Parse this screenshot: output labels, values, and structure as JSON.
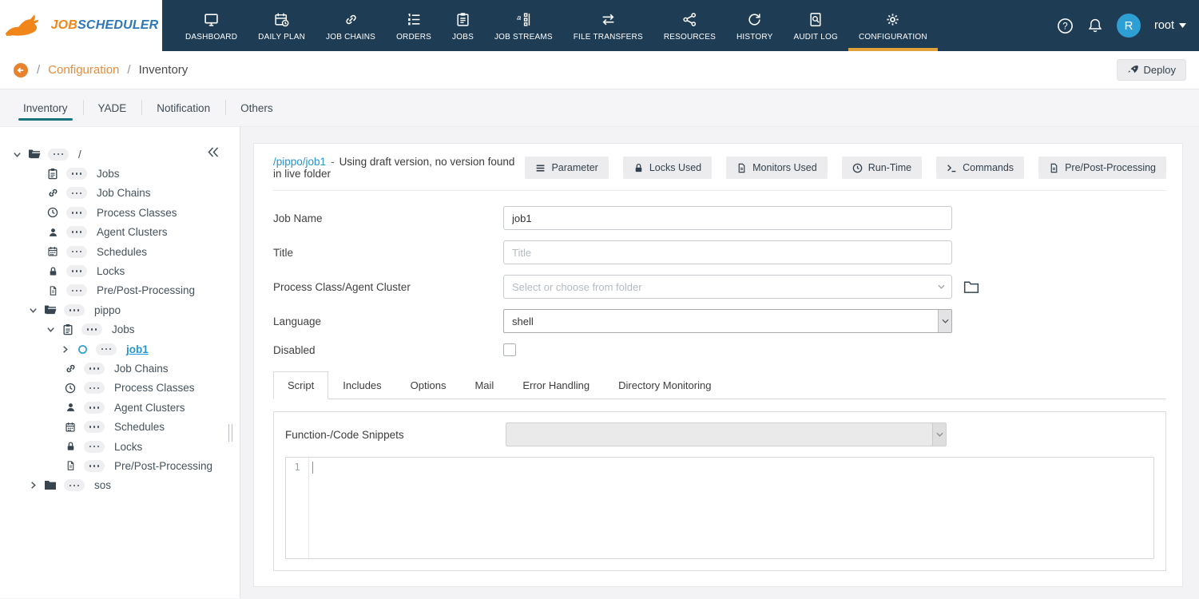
{
  "colors": {
    "navbar_bg": "#1e3c54",
    "brand_orange": "#f08519",
    "brand_blue": "#2e77b8",
    "nav_active_underline": "#e2a13b",
    "breadcrumb_link_orange": "#e78c3a",
    "tab_active_teal": "#17747c",
    "link_blue": "#2795d2",
    "avatar_blue": "#2e9fd4"
  },
  "navbar": {
    "brand": {
      "text_job": "JOB",
      "text_scheduler": "SCHEDULER",
      "logo_icon": "rabbit-logo-icon"
    },
    "items": [
      {
        "label": "DASHBOARD",
        "icon": "dashboard-icon",
        "active": false
      },
      {
        "label": "DAILY PLAN",
        "icon": "daily-plan-icon",
        "active": false
      },
      {
        "label": "JOB CHAINS",
        "icon": "job-chains-icon",
        "active": false
      },
      {
        "label": "ORDERS",
        "icon": "orders-icon",
        "active": false
      },
      {
        "label": "JOBS",
        "icon": "jobs-icon",
        "active": false
      },
      {
        "label": "JOB STREAMS",
        "icon": "job-streams-icon",
        "active": false
      },
      {
        "label": "FILE TRANSFERS",
        "icon": "file-transfers-icon",
        "active": false
      },
      {
        "label": "RESOURCES",
        "icon": "resources-icon",
        "active": false
      },
      {
        "label": "HISTORY",
        "icon": "history-icon",
        "active": false
      },
      {
        "label": "AUDIT LOG",
        "icon": "audit-log-icon",
        "active": false
      },
      {
        "label": "CONFIGURATION",
        "icon": "configuration-icon",
        "active": true
      }
    ],
    "right_icons": [
      "help-icon",
      "bell-icon"
    ],
    "user": {
      "initial": "R",
      "name": "root"
    }
  },
  "breadcrumb": {
    "back_icon": "back-circle-icon",
    "sep": "/",
    "section": "Configuration",
    "page": "Inventory",
    "deploy_label": "Deploy",
    "deploy_icon": "rocket-icon"
  },
  "page_tabs": [
    {
      "label": "Inventory",
      "active": true
    },
    {
      "label": "YADE",
      "active": false
    },
    {
      "label": "Notification",
      "active": false
    },
    {
      "label": "Others",
      "active": false
    }
  ],
  "tree": {
    "collapse_icon": "collapse-double-chevron-icon",
    "rows": [
      {
        "label": "/",
        "icon": "folder-open-icon",
        "chevron": "down",
        "level": 0
      },
      {
        "label": "Jobs",
        "icon": "clipboard-icon",
        "level": 1
      },
      {
        "label": "Job Chains",
        "icon": "chain-icon",
        "level": 1
      },
      {
        "label": "Process Classes",
        "icon": "clock-icon",
        "level": 1
      },
      {
        "label": "Agent Clusters",
        "icon": "user-icon",
        "level": 1
      },
      {
        "label": "Schedules",
        "icon": "calendar-icon",
        "level": 1
      },
      {
        "label": "Locks",
        "icon": "lock-icon",
        "level": 1
      },
      {
        "label": "Pre/Post-Processing",
        "icon": "document-icon",
        "level": 1
      },
      {
        "label": "pippo",
        "icon": "folder-open-icon",
        "chevron": "down",
        "level": 1
      },
      {
        "label": "Jobs",
        "icon": "clipboard-icon",
        "chevron": "down",
        "level": 2
      },
      {
        "label": "job1",
        "icon": "circle-icon",
        "chevron": "right",
        "level": 3,
        "selected": true
      },
      {
        "label": "Job Chains",
        "icon": "chain-icon",
        "level": 3
      },
      {
        "label": "Process Classes",
        "icon": "clock-icon",
        "level": 3
      },
      {
        "label": "Agent Clusters",
        "icon": "user-icon",
        "level": 3
      },
      {
        "label": "Schedules",
        "icon": "calendar-icon",
        "level": 3
      },
      {
        "label": "Locks",
        "icon": "lock-icon",
        "level": 3
      },
      {
        "label": "Pre/Post-Processing",
        "icon": "document-icon",
        "level": 3
      },
      {
        "label": "sos",
        "icon": "folder-closed-icon",
        "chevron": "right",
        "level": 1
      }
    ]
  },
  "main": {
    "title_path": "/pippo/job1",
    "title_sep": "-",
    "title_note": "Using draft version, no version found in live folder",
    "header_buttons": [
      {
        "label": "Parameter",
        "icon": "parameter-icon"
      },
      {
        "label": "Locks Used",
        "icon": "lock-icon"
      },
      {
        "label": "Monitors Used",
        "icon": "document-icon"
      },
      {
        "label": "Run-Time",
        "icon": "runtime-clock-icon"
      },
      {
        "label": "Commands",
        "icon": "terminal-icon"
      },
      {
        "label": "Pre/Post-Processing",
        "icon": "document-icon"
      }
    ],
    "form": {
      "job_name": {
        "label": "Job Name",
        "value": "job1"
      },
      "title": {
        "label": "Title",
        "placeholder": "Title"
      },
      "process_class": {
        "label": "Process Class/Agent Cluster",
        "placeholder": "Select or choose from folder",
        "folder_icon": "folder-outline-icon"
      },
      "language": {
        "label": "Language",
        "value": "shell"
      },
      "disabled": {
        "label": "Disabled",
        "checked": false
      }
    },
    "script_tabs": [
      {
        "label": "Script",
        "active": true
      },
      {
        "label": "Includes",
        "active": false
      },
      {
        "label": "Options",
        "active": false
      },
      {
        "label": "Mail",
        "active": false
      },
      {
        "label": "Error Handling",
        "active": false
      },
      {
        "label": "Directory Monitoring",
        "active": false
      }
    ],
    "snippets": {
      "label": "Function-/Code Snippets"
    },
    "editor": {
      "line_number": "1"
    }
  }
}
